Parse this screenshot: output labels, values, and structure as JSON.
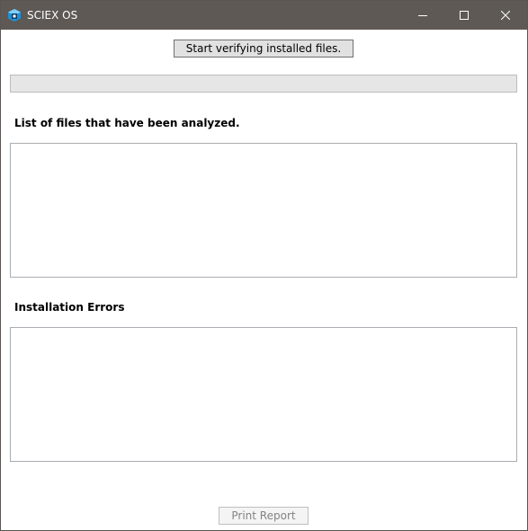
{
  "window": {
    "title": "SCIEX OS",
    "icon": "sciex-app-icon",
    "controls": [
      "minimize-icon",
      "maximize-icon",
      "close-icon"
    ]
  },
  "verify": {
    "button_label": "Start verifying installed files."
  },
  "progress": {
    "value": 0
  },
  "files_section": {
    "label": "List of files that have been analyzed.",
    "items": []
  },
  "errors_section": {
    "label": "Installation Errors",
    "items": []
  },
  "footer": {
    "print_label": "Print Report",
    "print_enabled": false
  },
  "colors": {
    "titlebar": "#5e5955",
    "icon_accent": "#1e90d6"
  }
}
